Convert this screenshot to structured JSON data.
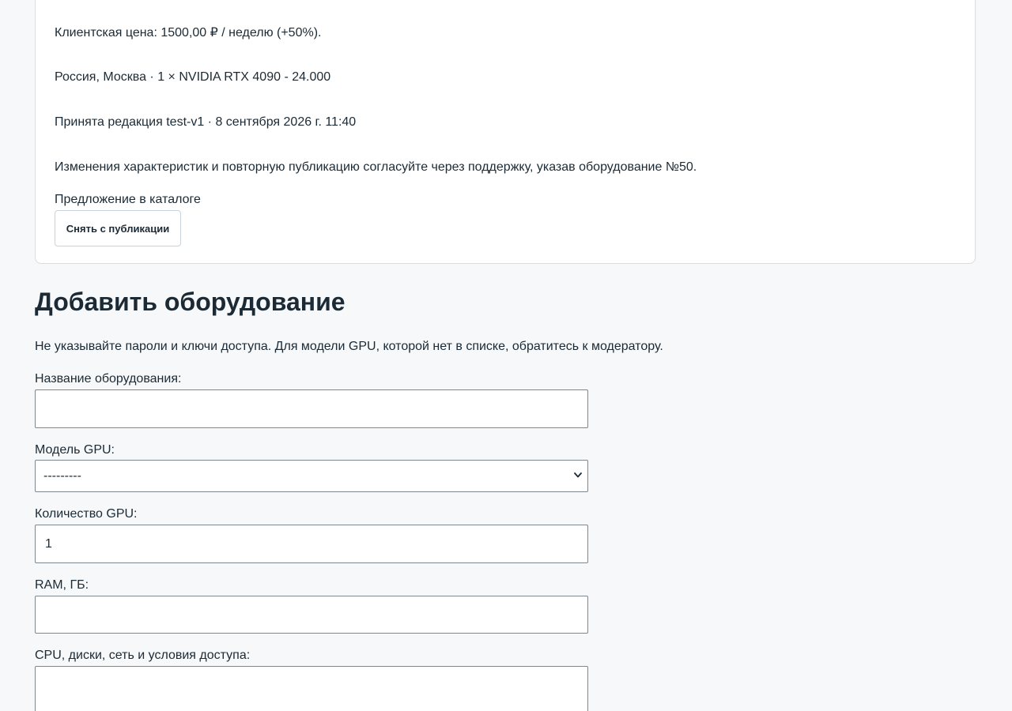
{
  "listing_card": {
    "client_price": "Клиентская цена: 1500,00 ₽ / неделю (+50%).",
    "location_spec": "Россия, Москва · 1 × NVIDIA RTX 4090 - 24.000",
    "accepted_revision": "Принята редакция test-v1 · 8 сентября 2026 г. 11:40",
    "support_notice": "Изменения характеристик и повторную публикацию согласуйте через поддержку, указав оборудование №50.",
    "catalog_label": "Предложение в каталоге",
    "unpublish_label": "Снять с публикации"
  },
  "add_form": {
    "title": "Добавить оборудование",
    "hint": "Не указывайте пароли и ключи доступа. Для модели GPU, которой нет в списке, обратитесь к модератору.",
    "name": {
      "label": "Название оборудования:",
      "value": ""
    },
    "gpu_model": {
      "label": "Модель GPU:",
      "selected": "---------"
    },
    "gpu_count": {
      "label": "Количество GPU:",
      "value": "1"
    },
    "ram": {
      "label": "RAM, ГБ:",
      "value": ""
    },
    "details": {
      "label": "CPU, диски, сеть и условия доступа:",
      "value": ""
    }
  }
}
